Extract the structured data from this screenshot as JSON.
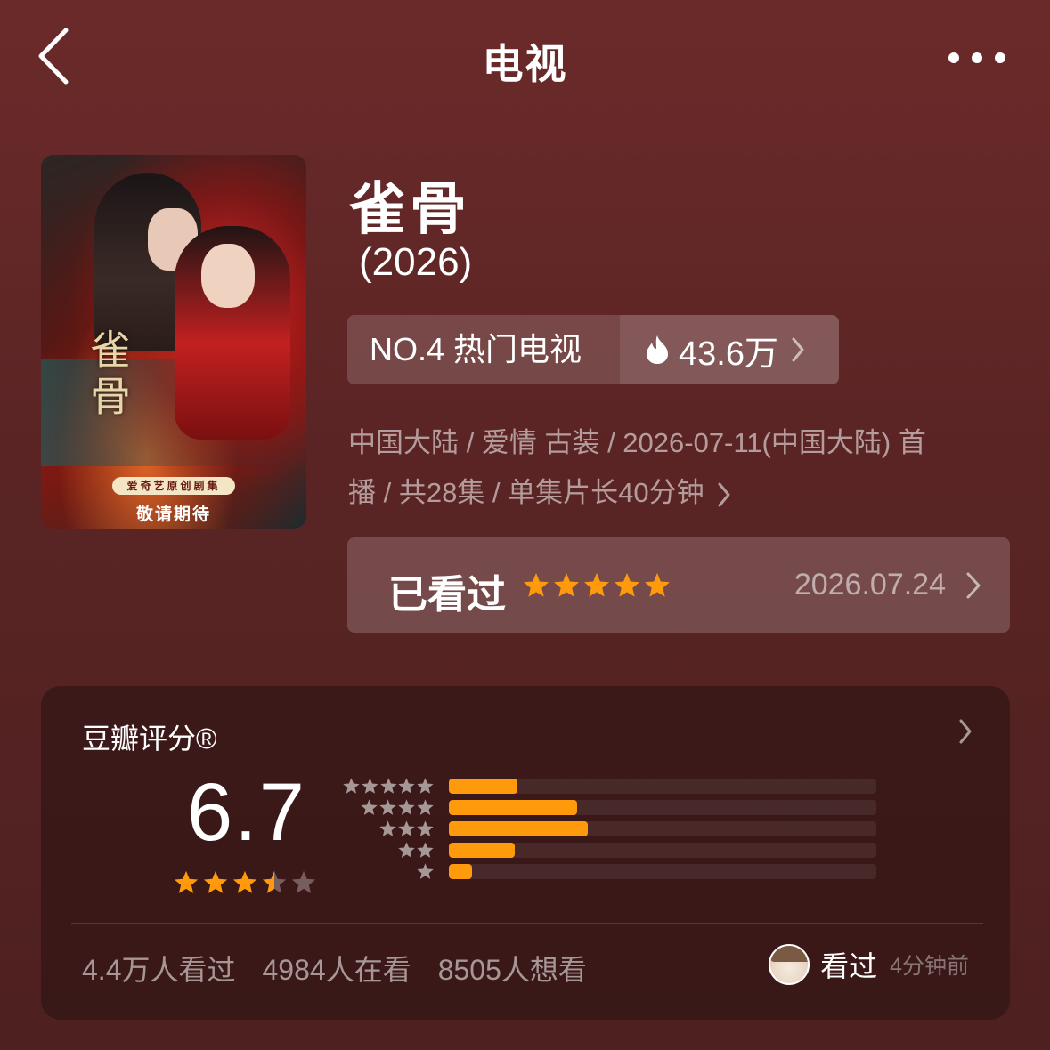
{
  "header": {
    "title": "电视"
  },
  "poster": {
    "title_glyphs": "雀骨",
    "badge": "爱奇艺原创剧集",
    "subtitle": "敬请期待"
  },
  "show": {
    "title": "雀骨",
    "year": "(2026)",
    "rank_label": "NO.4 热门电视",
    "heat": "43.6万",
    "meta_line1": "中国大陆 / 爱情 古装 / 2026-07-11(中国大陆) 首",
    "meta_line2": "播 / 共28集 / 单集片长40分钟"
  },
  "watched": {
    "label": "已看过",
    "stars": 5,
    "date": "2026.07.24"
  },
  "rating": {
    "header": "豆瓣评分®",
    "score": "6.7",
    "stars": 3.5,
    "distribution_fraction": {
      "5": 0.16,
      "4": 0.3,
      "3": 0.325,
      "2": 0.155,
      "1": 0.055
    }
  },
  "stats": {
    "watched": "4.4万人看过",
    "watching": "4984人在看",
    "want": "8505人想看"
  },
  "friend": {
    "action": "看过",
    "time": "4分钟前"
  },
  "colors": {
    "star": "#ff9a0c",
    "accent_bar": "#ff9a0c",
    "bg": "#5a2424"
  },
  "icons": [
    "back-chevron-icon",
    "more-dots-icon",
    "flame-icon",
    "chevron-right-icon",
    "star-icon",
    "avatar"
  ]
}
